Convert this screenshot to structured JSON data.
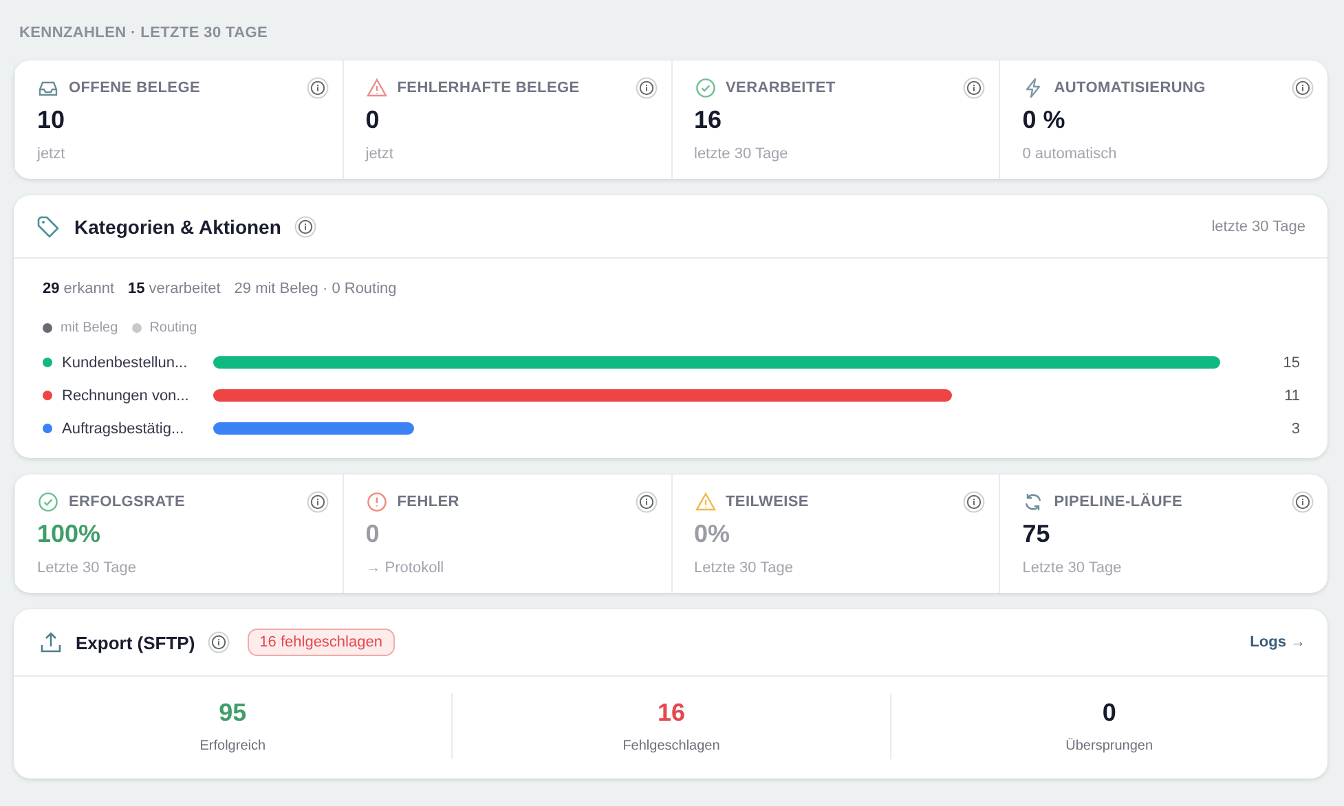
{
  "section_title": "KENNZAHLEN · LETZTE 30 TAGE",
  "kpis_top": [
    {
      "label": "OFFENE BELEGE",
      "value": "10",
      "note": "jetzt"
    },
    {
      "label": "FEHLERHAFTE BELEGE",
      "value": "0",
      "note": "jetzt"
    },
    {
      "label": "VERARBEITET",
      "value": "16",
      "note": "letzte 30 Tage"
    },
    {
      "label": "AUTOMATISIERUNG",
      "value": "0 %",
      "note": "0 automatisch"
    }
  ],
  "categories": {
    "title": "Kategorien & Aktionen",
    "period": "letzte 30 Tage",
    "stats": [
      "**29** erkannt",
      "**15** verarbeitet",
      "29 mit Beleg · 0 Routing"
    ],
    "legend": [
      {
        "label": "mit Beleg",
        "color": "#6b6a74"
      },
      {
        "label": "Routing",
        "color": "#c9c9cc"
      }
    ],
    "items": [
      {
        "name": "Kundenbestellun...",
        "count": "15",
        "color": "#10b981"
      },
      {
        "name": "Rechnungen von...",
        "count": "11",
        "color": "#ef4444"
      },
      {
        "name": "Auftragsbestätig...",
        "count": "3",
        "color": "#3b82f6"
      }
    ]
  },
  "kpis_pipeline": [
    {
      "label": "ERFOLGSRATE",
      "value": "100%",
      "note": "Letzte 30 Tage"
    },
    {
      "label": "FEHLER",
      "value": "0",
      "note": "→ Protokoll"
    },
    {
      "label": "TEILWEISE",
      "value": "0%",
      "note": "Letzte 30 Tage"
    },
    {
      "label": "PIPELINE-LÄUFE",
      "value": "75",
      "note": "Letzte 30 Tage"
    }
  ],
  "export": {
    "title": "Export (SFTP)",
    "badge": "16 fehlgeschlagen",
    "link": "Logs →",
    "stats": [
      {
        "value": "95",
        "label": "Erfolgreich"
      },
      {
        "value": "16",
        "label": "Fehlgeschlagen"
      },
      {
        "value": "0",
        "label": "Übersprungen"
      }
    ]
  }
}
